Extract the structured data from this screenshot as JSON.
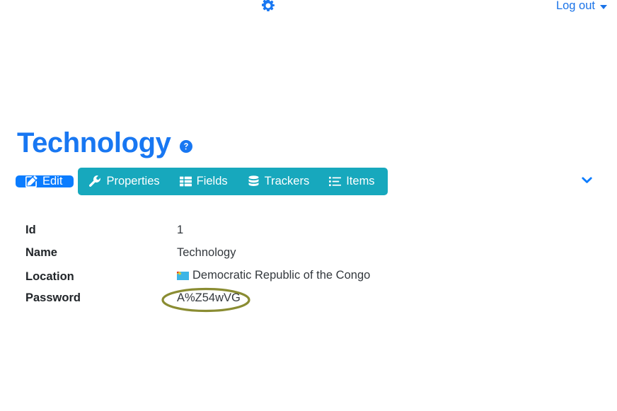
{
  "topbar": {
    "settings_icon": "gear-icon",
    "logout_label": "Log out",
    "logout_caret_icon": "caret-down-icon"
  },
  "heading": {
    "title": "Technology",
    "help_icon": "question-circle-icon"
  },
  "toolbar": {
    "edit": {
      "label": "Edit",
      "icon": "pencil-square-icon",
      "style": "primary"
    },
    "items": [
      {
        "label": "Properties",
        "icon": "wrench-icon"
      },
      {
        "label": "Fields",
        "icon": "table-columns-icon"
      },
      {
        "label": "Trackers",
        "icon": "database-icon"
      },
      {
        "label": "Items",
        "icon": "list-ul-icon"
      }
    ],
    "expand_icon": "chevron-down-icon"
  },
  "details": {
    "rows": [
      {
        "label": "Id",
        "value": "1"
      },
      {
        "label": "Name",
        "value": "Technology"
      },
      {
        "label": "Location",
        "value": "Democratic Republic of the Congo",
        "icon": "flag-cd-icon"
      },
      {
        "label": "Password",
        "value": "A%Z54wVG",
        "annotated": true
      }
    ]
  },
  "annotation": {
    "shape": "ellipse",
    "target": "password-value",
    "color": "#8a8c32"
  },
  "colors": {
    "primary_blue": "#0a7cff",
    "title_blue": "#1877f2",
    "link_blue": "#1a73e8",
    "info_teal": "#17a8bd",
    "text_dark": "#212529",
    "value_text": "#33383d",
    "annotation_olive": "#8a8c32",
    "background": "#ffffff"
  }
}
